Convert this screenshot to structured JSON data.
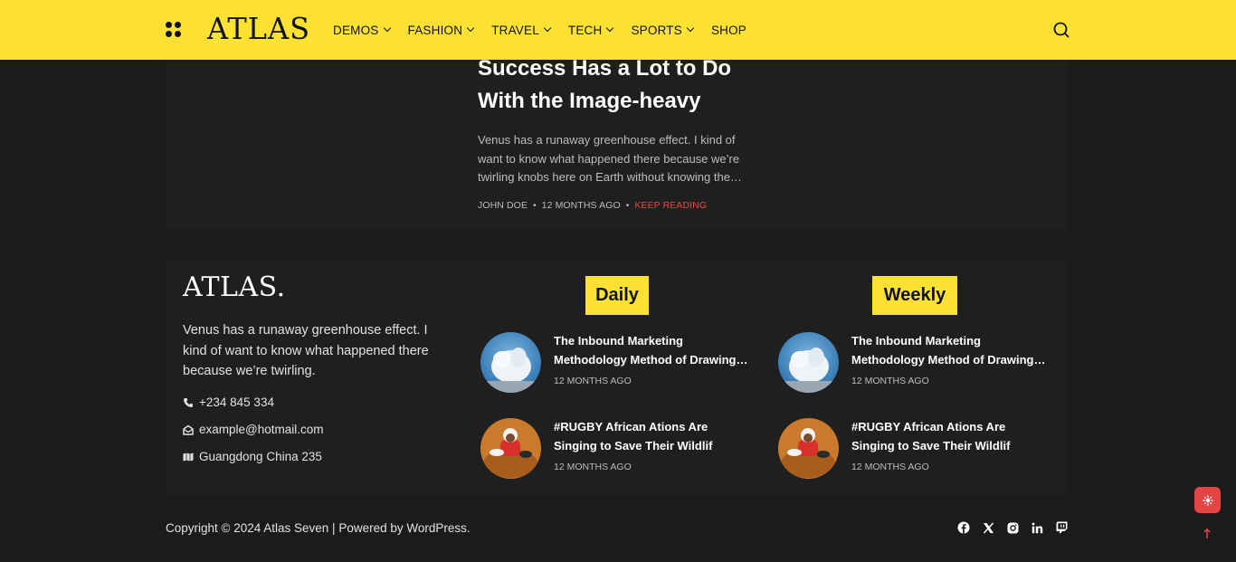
{
  "header": {
    "brand": "ATLAS",
    "nav": [
      {
        "label": "DEMOS",
        "has_dropdown": true
      },
      {
        "label": "FASHION",
        "has_dropdown": true
      },
      {
        "label": "TRAVEL",
        "has_dropdown": true
      },
      {
        "label": "TECH",
        "has_dropdown": true
      },
      {
        "label": "SPORTS",
        "has_dropdown": true
      },
      {
        "label": "SHOP",
        "has_dropdown": false
      }
    ],
    "search_icon": "search-icon",
    "menu_icon": "grid-dots-icon"
  },
  "article": {
    "title": "Success Has a Lot to Do With the Image-heavy",
    "excerpt": "Venus has a runaway greenhouse effect. I kind of want to know what happened there because we’re twirling knobs here on Earth without knowing the…",
    "author": "JOHN DOE",
    "date": "12 MONTHS AGO",
    "read_more": "KEEP READING"
  },
  "footer": {
    "logo": "ATLAS.",
    "description": "Venus has a runaway greenhouse effect. I kind of want to know what happened there because we’re twirling.",
    "phone": "+234 845 334",
    "email": "example@hotmail.com",
    "address": "Guangdong China 235",
    "daily": {
      "heading": "Daily",
      "posts": [
        {
          "title": "The Inbound Marketing Methodology Method of Drawing Customers",
          "date": "12 MONTHS AGO"
        },
        {
          "title": "#RUGBY African Ations Are Singing to Save Their Wildlif",
          "date": "12 MONTHS AGO"
        }
      ]
    },
    "weekly": {
      "heading": "Weekly",
      "posts": [
        {
          "title": "The Inbound Marketing Methodology Method of Drawing Customers",
          "date": "12 MONTHS AGO"
        },
        {
          "title": "#RUGBY African Ations Are Singing to Save Their Wildlif",
          "date": "12 MONTHS AGO"
        }
      ]
    }
  },
  "bottom": {
    "copyright": "Copyright © 2024 Atlas Seven | Powered by WordPress.",
    "social": [
      "facebook-icon",
      "x-icon",
      "instagram-icon",
      "linkedin-icon",
      "twitch-icon"
    ]
  },
  "colors": {
    "accent_yellow": "#fde233",
    "accent_red": "#e34b3c",
    "background": "#1b1b1b",
    "card": "#1f1f1f"
  }
}
